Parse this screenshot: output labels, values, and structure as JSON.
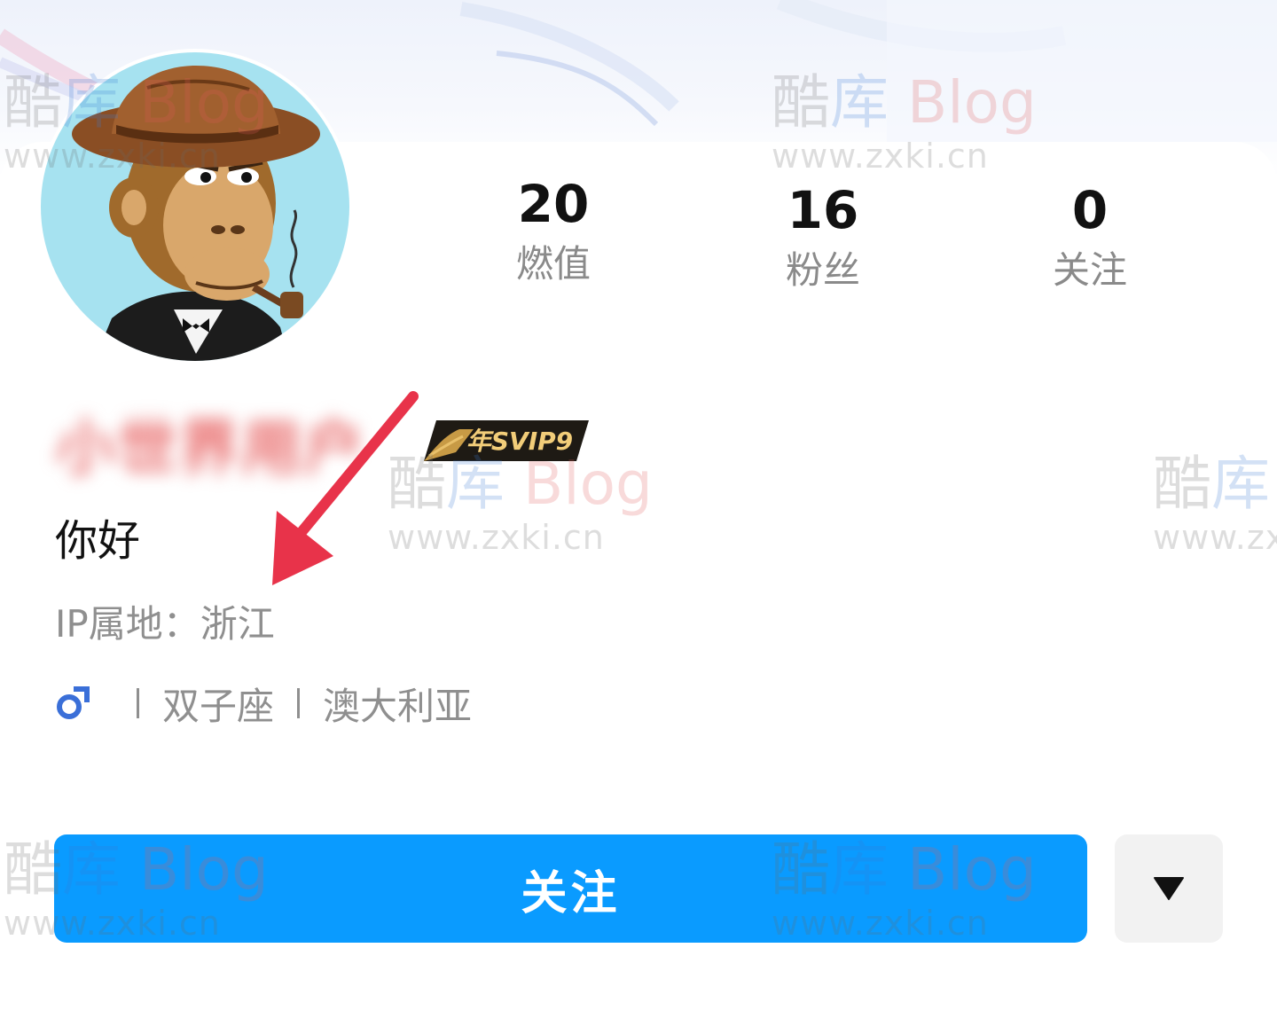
{
  "profile": {
    "username": "小世界用户",
    "vip_badge": "年SVIP9",
    "bio": "你好",
    "ip_location": "IP属地：浙江",
    "tags": {
      "gender": "male",
      "zodiac": "双子座",
      "country": "澳大利亚"
    }
  },
  "stats": [
    {
      "value": "20",
      "label": "燃值"
    },
    {
      "value": "16",
      "label": "粉丝"
    },
    {
      "value": "0",
      "label": "关注"
    }
  ],
  "actions": {
    "follow_label": "关注",
    "more_icon": "caret-down-icon"
  },
  "watermark": {
    "brand_1": "酷",
    "brand_2": "库",
    "brand_3": "Blog",
    "url": "www.zxki.cn"
  },
  "colors": {
    "follow_button": "#0a9bff",
    "annotation_arrow": "#e8334a",
    "gender_icon": "#3a6fd8"
  }
}
